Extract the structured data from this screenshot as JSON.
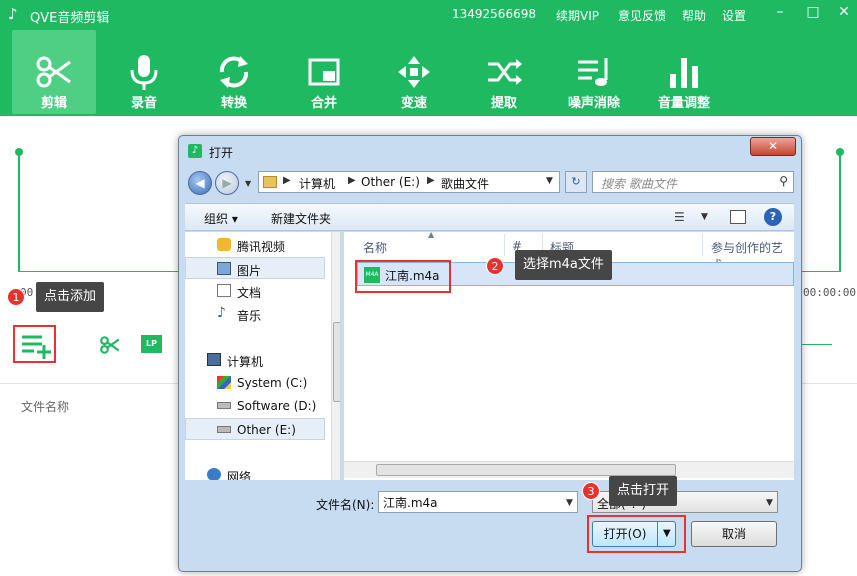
{
  "app": {
    "title": "QVE音频剪辑",
    "phone": "13492566698",
    "nav": [
      "续期VIP",
      "意见反馈",
      "帮助",
      "设置"
    ],
    "tools": [
      {
        "label": "剪辑",
        "icon": "scissors-icon",
        "active": true
      },
      {
        "label": "录音",
        "icon": "microphone-icon"
      },
      {
        "label": "转换",
        "icon": "convert-icon"
      },
      {
        "label": "合并",
        "icon": "merge-icon"
      },
      {
        "label": "变速",
        "icon": "speed-icon"
      },
      {
        "label": "提取",
        "icon": "extract-icon"
      },
      {
        "label": "噪声消除",
        "icon": "noise-removal-icon"
      },
      {
        "label": "音量调整",
        "icon": "volume-icon"
      }
    ],
    "timecode_left": "00:00",
    "timecode_right": "00:00:00",
    "lp_label": "LP",
    "file_column": "文件名称"
  },
  "callouts": [
    {
      "num": "1",
      "text": "点击添加"
    },
    {
      "num": "2",
      "text": "选择m4a文件"
    },
    {
      "num": "3",
      "text": "点击打开"
    }
  ],
  "dialog": {
    "title": "打开",
    "breadcrumb": [
      "计算机",
      "Other (E:)",
      "歌曲文件"
    ],
    "search_placeholder": "搜索 歌曲文件",
    "organize": "组织 ▾",
    "new_folder": "新建文件夹",
    "nav_items": [
      {
        "label": "腾讯视频",
        "icon": "tencent-video-icon"
      },
      {
        "label": "图片",
        "icon": "pictures-icon",
        "selected": true
      },
      {
        "label": "文档",
        "icon": "documents-icon"
      },
      {
        "label": "音乐",
        "icon": "music-icon"
      },
      {
        "label": "计算机",
        "icon": "computer-icon"
      },
      {
        "label": "System (C:)",
        "icon": "drive-c-icon"
      },
      {
        "label": "Software (D:)",
        "icon": "drive-d-icon"
      },
      {
        "label": "Other (E:)",
        "icon": "drive-e-icon",
        "selected": true
      },
      {
        "label": "网络",
        "icon": "network-icon"
      }
    ],
    "columns": [
      "名称",
      "#",
      "标题",
      "参与创作的艺术"
    ],
    "files": [
      {
        "name": "江南.m4a",
        "icon_text": "M4A"
      }
    ],
    "filename_label": "文件名(N):",
    "filename_value": "江南.m4a",
    "filetype_value": "全部(*.*)",
    "open_button": "打开(O)",
    "cancel_button": "取消"
  }
}
